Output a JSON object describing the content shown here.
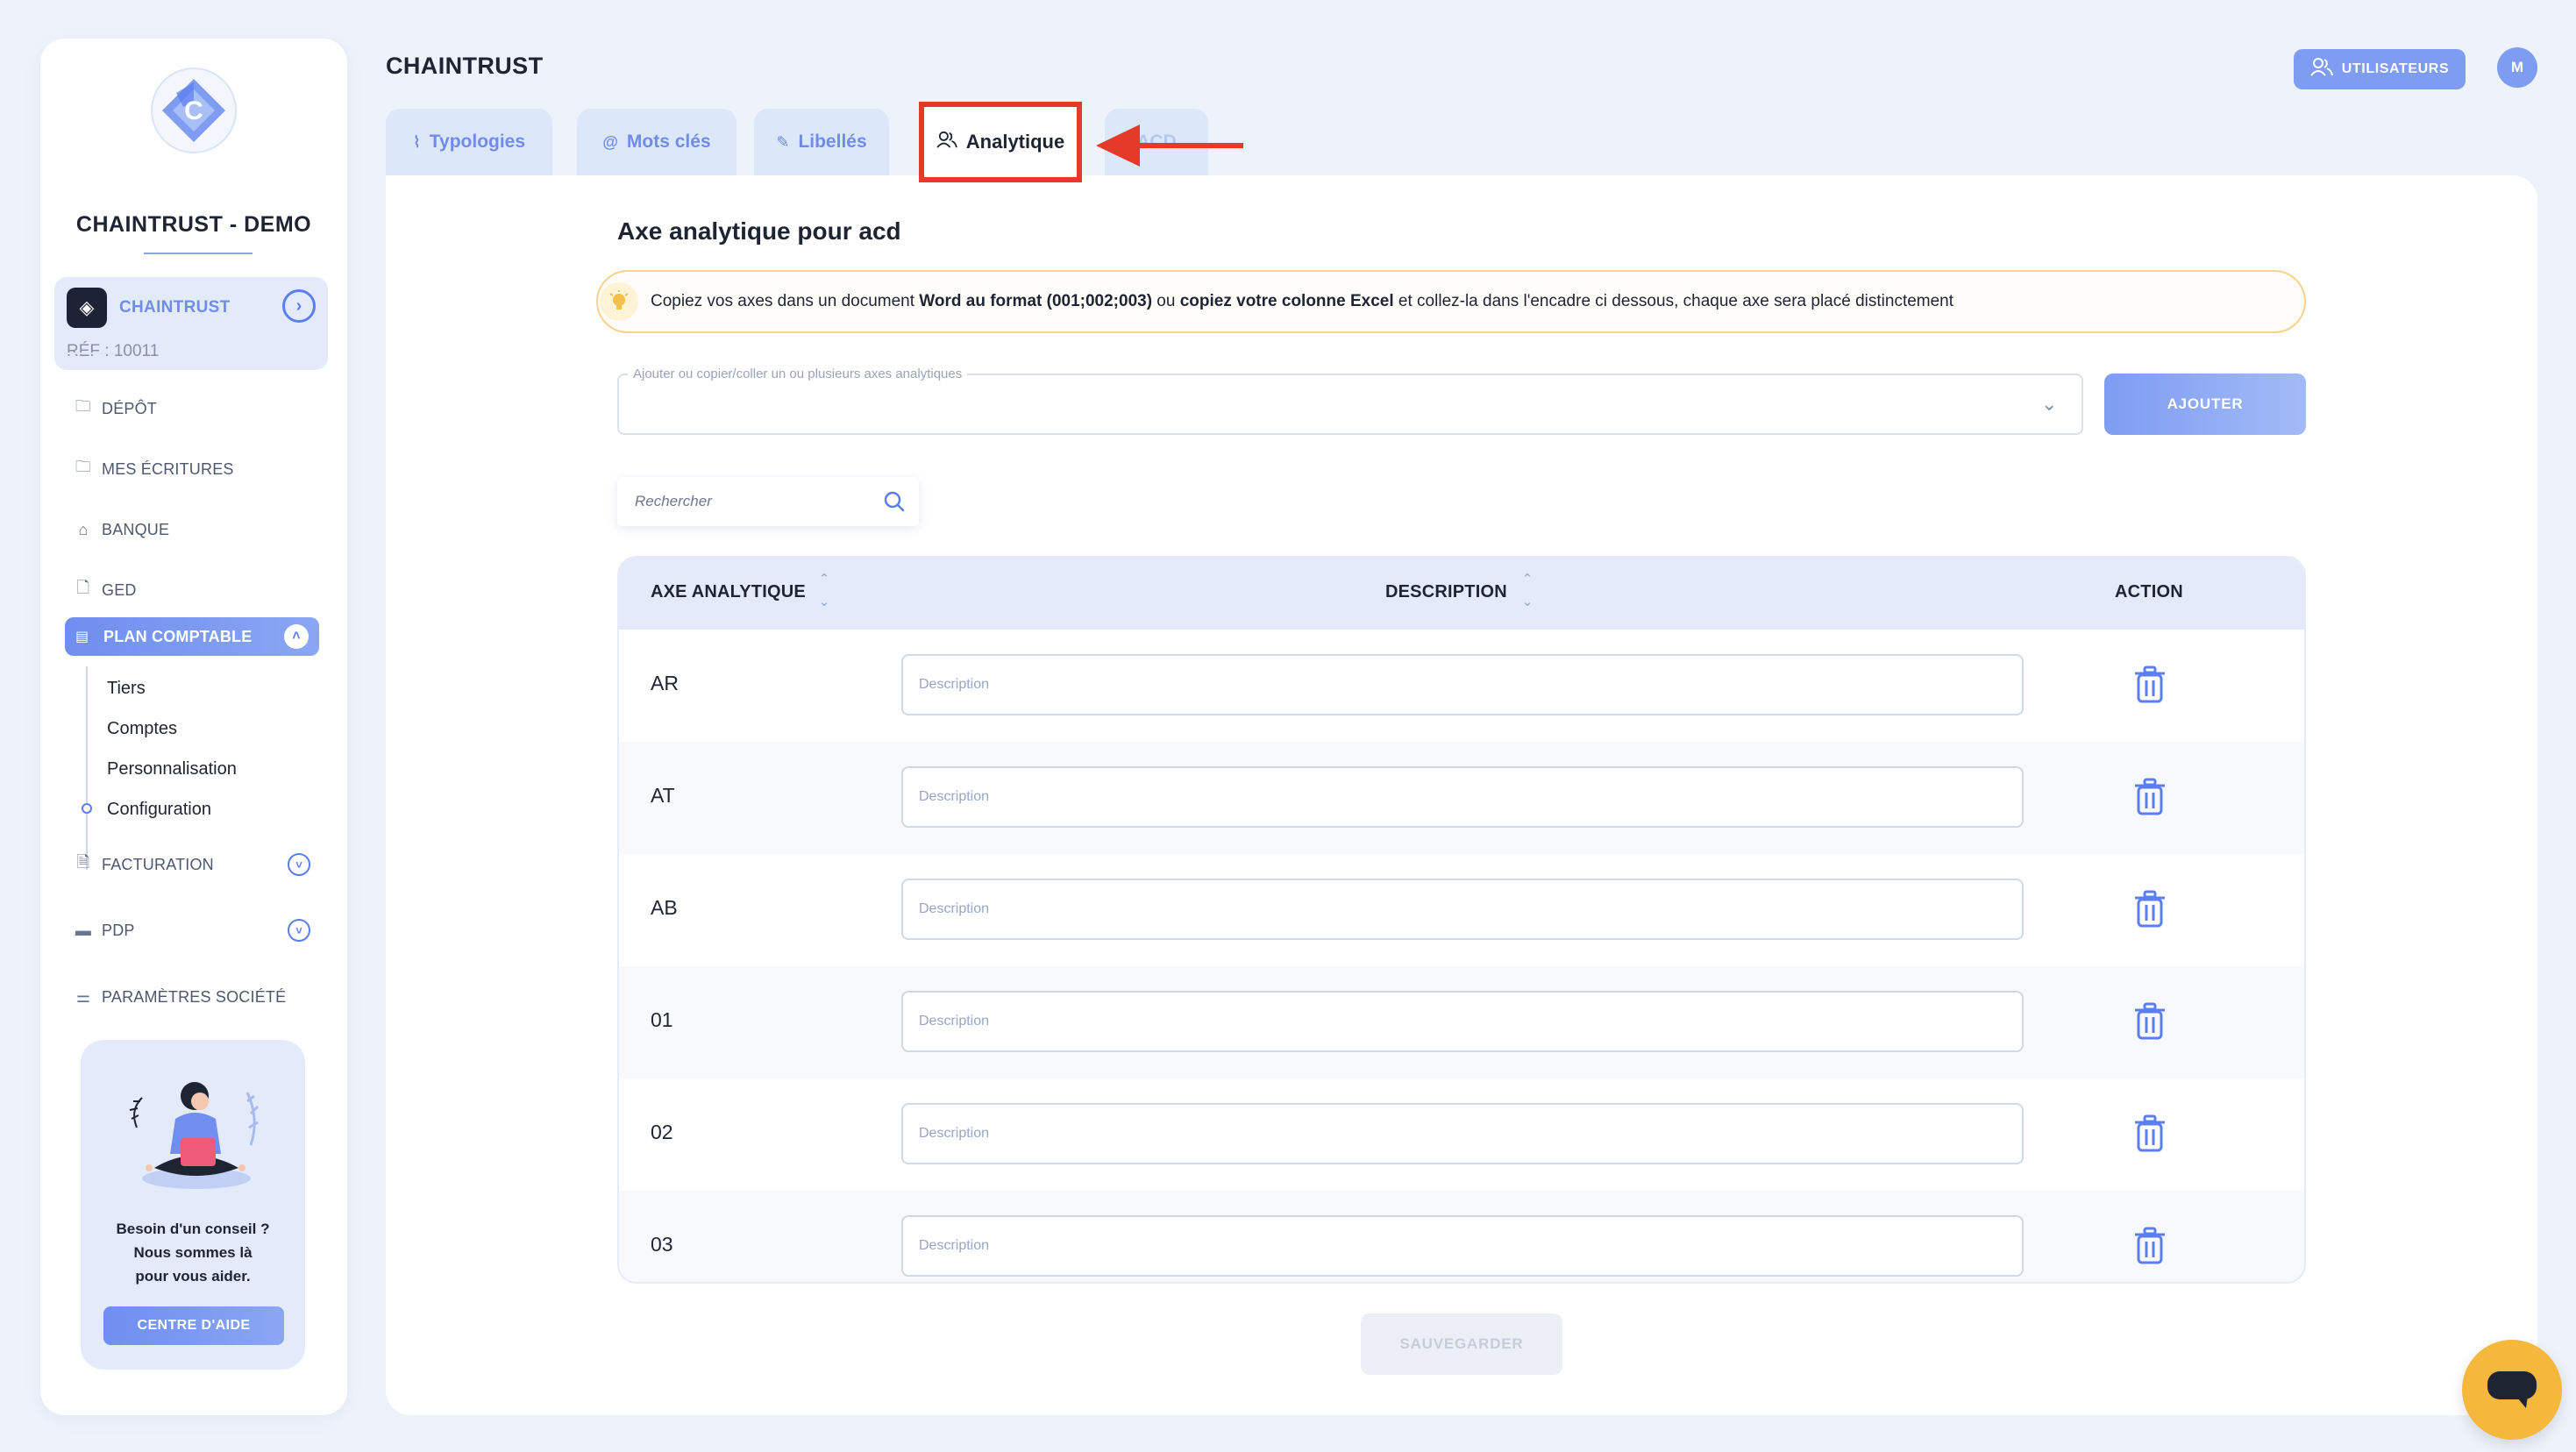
{
  "sidebar": {
    "company_name": "CHAINTRUST - DEMO",
    "client": {
      "name": "CHAINTRUST",
      "ref": "RÉF : 10011"
    },
    "nav": [
      {
        "label": "DÉPÔT",
        "icon": "folder-upload-icon"
      },
      {
        "label": "MES ÉCRITURES",
        "icon": "folder-edit-icon"
      },
      {
        "label": "BANQUE",
        "icon": "bank-icon"
      },
      {
        "label": "GED",
        "icon": "document-icon"
      }
    ],
    "active_nav": {
      "label": "PLAN COMPTABLE",
      "icon": "ledger-icon"
    },
    "sub_items": [
      "Tiers",
      "Comptes",
      "Personnalisation",
      "Configuration"
    ],
    "nav_bottom": [
      {
        "label": "FACTURATION",
        "icon": "invoice-icon"
      },
      {
        "label": "PDP",
        "icon": "card-icon"
      },
      {
        "label": "PARAMÈTRES SOCIÉTÉ",
        "icon": "sliders-icon"
      }
    ],
    "help": {
      "line1": "Besoin d'un conseil ?",
      "line2": "Nous sommes là",
      "line3": "pour vous aider.",
      "button": "CENTRE D'AIDE"
    }
  },
  "header": {
    "title": "CHAINTRUST",
    "users_button": "UTILISATEURS",
    "avatar_initial": "M"
  },
  "tabs": [
    {
      "label": "Typologies",
      "icon": "paperclip-icon"
    },
    {
      "label": "Mots clés",
      "icon": "at-icon"
    },
    {
      "label": "Libellés",
      "icon": "pen-icon"
    },
    {
      "label": "Analytique",
      "icon": "users-icon",
      "active": true
    },
    {
      "label": "ACD",
      "icon": ""
    }
  ],
  "main": {
    "section_title": "Axe analytique pour acd",
    "info": {
      "t1": "Copiez vos axes dans un document ",
      "b1": "Word au format (001;002;003)",
      "t2": " ou ",
      "b2": "copiez votre colonne Excel",
      "t3": " et collez-la dans l'encadre ci dessous, chaque axe sera placé distinctement"
    },
    "add_field_label": "Ajouter ou copier/coller un ou plusieurs axes analytiques",
    "add_button": "AJOUTER",
    "search_placeholder": "Rechercher",
    "table": {
      "headers": {
        "axe": "AXE ANALYTIQUE",
        "description": "DESCRIPTION",
        "action": "ACTION"
      },
      "desc_placeholder": "Description",
      "rows": [
        {
          "axe": "AR"
        },
        {
          "axe": "AT"
        },
        {
          "axe": "AB"
        },
        {
          "axe": "01"
        },
        {
          "axe": "02"
        },
        {
          "axe": "03"
        }
      ]
    },
    "save_button": "SAUVEGARDER"
  },
  "colors": {
    "accent": "#6f8ef0",
    "highlight_annotation": "#e53a2a",
    "chat_button": "#f5b73c"
  }
}
